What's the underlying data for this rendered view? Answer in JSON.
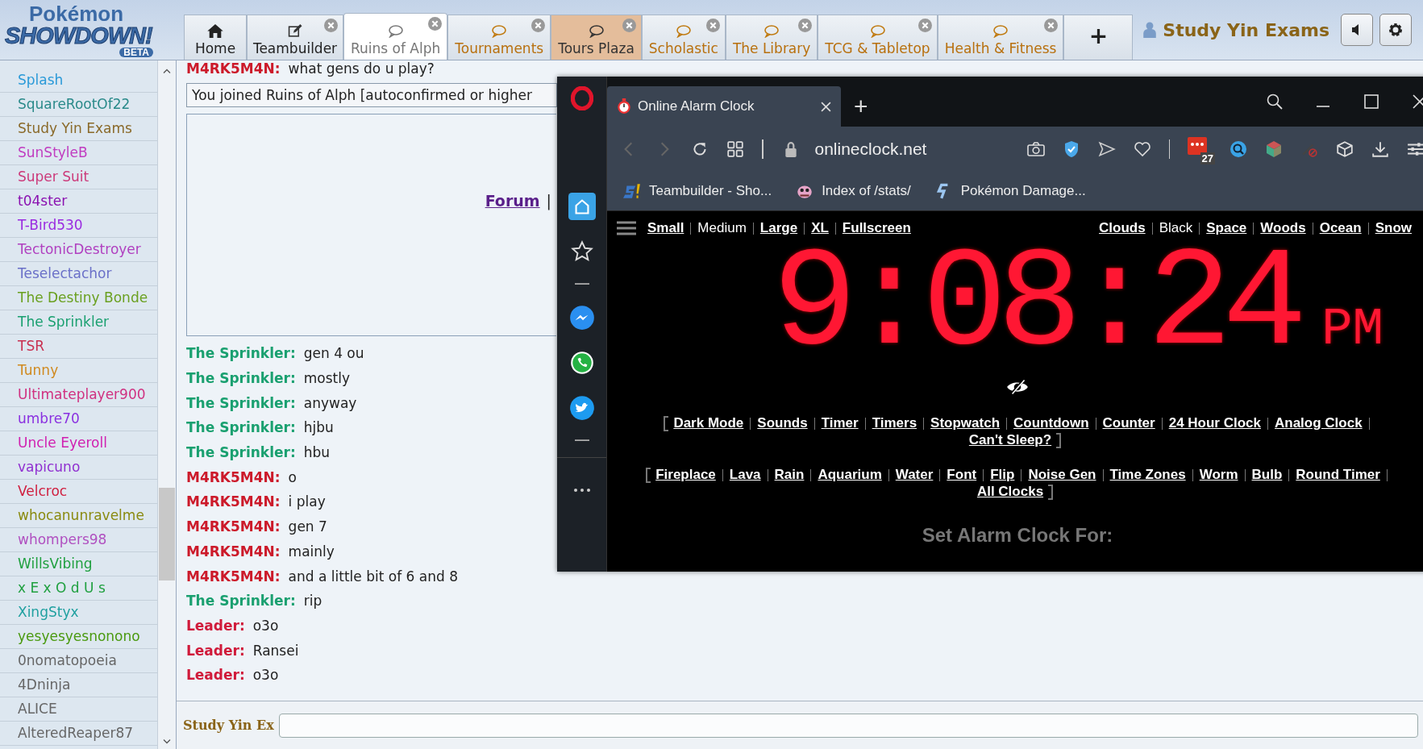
{
  "logo": {
    "line1": "Pokémon",
    "line2": "SHOWDOWN!",
    "badge": "BETA"
  },
  "tabs": [
    {
      "kind": "home",
      "label": "Home",
      "selected": false,
      "hovered": false,
      "unread": false
    },
    {
      "kind": "teambuilder",
      "label": "Teambuilder",
      "selected": false,
      "hovered": false,
      "unread": false
    },
    {
      "kind": "room",
      "label": "Ruins of Alph",
      "selected": true,
      "hovered": false,
      "unread": false
    },
    {
      "kind": "room",
      "label": "Tournaments",
      "selected": false,
      "hovered": false,
      "unread": true
    },
    {
      "kind": "room",
      "label": "Tours Plaza",
      "selected": false,
      "hovered": true,
      "unread": false
    },
    {
      "kind": "room",
      "label": "Scholastic",
      "selected": false,
      "hovered": false,
      "unread": true
    },
    {
      "kind": "room",
      "label": "The Library",
      "selected": false,
      "hovered": false,
      "unread": true
    },
    {
      "kind": "room",
      "label": "TCG & Tabletop",
      "selected": false,
      "hovered": false,
      "unread": true
    },
    {
      "kind": "room",
      "label": "Health & Fitness",
      "selected": false,
      "hovered": false,
      "unread": true
    },
    {
      "kind": "new",
      "label": "+",
      "selected": false,
      "hovered": false,
      "unread": false
    }
  ],
  "user": {
    "name": "Study Yin Exams"
  },
  "userlist": [
    {
      "name": "Splash",
      "color": "#2a9ad8"
    },
    {
      "name": "SquareRootOf22",
      "color": "#2a8a8a"
    },
    {
      "name": "Study Yin Exams",
      "color": "#8a6a2a"
    },
    {
      "name": "SunStyleB",
      "color": "#c03cc0"
    },
    {
      "name": "Super Suit",
      "color": "#cc3a7a"
    },
    {
      "name": "t04ster",
      "color": "#8a10b0"
    },
    {
      "name": "T-Bird530",
      "color": "#9a2ae0"
    },
    {
      "name": "TectonicDestroyer",
      "color": "#b040c0"
    },
    {
      "name": "Teselectachor",
      "color": "#6a70c8"
    },
    {
      "name": "The Destiny Bonde",
      "color": "#6aa020"
    },
    {
      "name": "The Sprinkler",
      "color": "#1aa070"
    },
    {
      "name": "TSR",
      "color": "#c83050"
    },
    {
      "name": "Tunny",
      "color": "#d08a20"
    },
    {
      "name": "Ultimateplayer900",
      "color": "#d03080"
    },
    {
      "name": "umbre70",
      "color": "#8a30e0"
    },
    {
      "name": "Uncle Eyeroll",
      "color": "#d020b0"
    },
    {
      "name": "vapicuno",
      "color": "#9030d0"
    },
    {
      "name": "Velcroc",
      "color": "#d02040"
    },
    {
      "name": "whocanunravelme",
      "color": "#8a8a10"
    },
    {
      "name": "whompers98",
      "color": "#b050c0"
    },
    {
      "name": "WillsVibing",
      "color": "#20a040"
    },
    {
      "name": "x E x O d U s",
      "color": "#20a040"
    },
    {
      "name": "XingStyx",
      "color": "#20a0a0"
    },
    {
      "name": "yesyesyesnonono",
      "color": "#4a9a10"
    },
    {
      "name": "0nomatopoeia",
      "color": "#666666"
    },
    {
      "name": "4Dninja",
      "color": "#666666"
    },
    {
      "name": "ALICE",
      "color": "#666666"
    },
    {
      "name": "AlteredReaper87",
      "color": "#666666"
    }
  ],
  "chat": {
    "top_line": {
      "user": "M4RK5M4N:",
      "text": "what gens do u play?",
      "color": "#cc1a2a"
    },
    "notice": "You joined Ruins of Alph [autoconfirmed or higher",
    "intro": {
      "link": "Forum",
      "separator": "|"
    },
    "messages": [
      {
        "user": "The Sprinkler:",
        "text": "gen 4 ou",
        "color": "#1aa070"
      },
      {
        "user": "The Sprinkler:",
        "text": "mostly",
        "color": "#1aa070"
      },
      {
        "user": "The Sprinkler:",
        "text": "anyway",
        "color": "#1aa070"
      },
      {
        "user": "The Sprinkler:",
        "text": "hjbu",
        "color": "#1aa070"
      },
      {
        "user": "The Sprinkler:",
        "text": "hbu",
        "color": "#1aa070"
      },
      {
        "user": "M4RK5M4N:",
        "text": "o",
        "color": "#cc1a2a"
      },
      {
        "user": "M4RK5M4N:",
        "text": "i play",
        "color": "#cc1a2a"
      },
      {
        "user": "M4RK5M4N:",
        "text": "gen 7",
        "color": "#cc1a2a"
      },
      {
        "user": "M4RK5M4N:",
        "text": "mainly",
        "color": "#cc1a2a"
      },
      {
        "user": "M4RK5M4N:",
        "text": "and a little bit of 6 and 8",
        "color": "#cc1a2a"
      },
      {
        "user": "The Sprinkler:",
        "text": "rip",
        "color": "#1aa070"
      },
      {
        "user": "Leader:",
        "text": "o3o",
        "color": "#d01a3a"
      },
      {
        "user": "Leader:",
        "text": "Ransei",
        "color": "#d01a3a"
      },
      {
        "user": "Leader:",
        "text": "o3o",
        "color": "#d01a3a"
      }
    ],
    "input": {
      "label": "Study Yin Ex"
    }
  },
  "browser": {
    "tab": {
      "title": "Online Alarm Clock"
    },
    "new_tab": "+",
    "address": "onlineclock.net",
    "badge": "27",
    "bookmarks": [
      {
        "kind": "showdown",
        "label": "Teambuilder - Sho..."
      },
      {
        "kind": "creature",
        "label": "Index of /stats/"
      },
      {
        "kind": "calc",
        "label": "Pokémon Damage..."
      }
    ],
    "page": {
      "sizes": [
        {
          "label": "Small",
          "selected": false
        },
        {
          "label": "Medium",
          "selected": true
        },
        {
          "label": "Large",
          "selected": false
        },
        {
          "label": "XL",
          "selected": false
        },
        {
          "label": "Fullscreen",
          "selected": false
        }
      ],
      "themes": [
        {
          "label": "Clouds",
          "selected": false
        },
        {
          "label": "Black",
          "selected": true
        },
        {
          "label": "Space",
          "selected": false
        },
        {
          "label": "Woods",
          "selected": false
        },
        {
          "label": "Ocean",
          "selected": false
        },
        {
          "label": "Snow",
          "selected": false
        }
      ],
      "time": "9:08:24",
      "ampm": "PM",
      "link_groups": [
        [
          "Dark Mode",
          "Sounds",
          "Timer",
          "Timers",
          "Stopwatch",
          "Countdown",
          "Counter",
          "24 Hour Clock",
          "Analog Clock",
          "Can't Sleep?"
        ],
        [
          "Fireplace",
          "Lava",
          "Rain",
          "Aquarium",
          "Water",
          "Font",
          "Flip",
          "Noise Gen",
          "Time Zones",
          "Worm",
          "Bulb",
          "Round Timer",
          "All Clocks"
        ]
      ],
      "heading": "Set Alarm Clock For:"
    }
  }
}
